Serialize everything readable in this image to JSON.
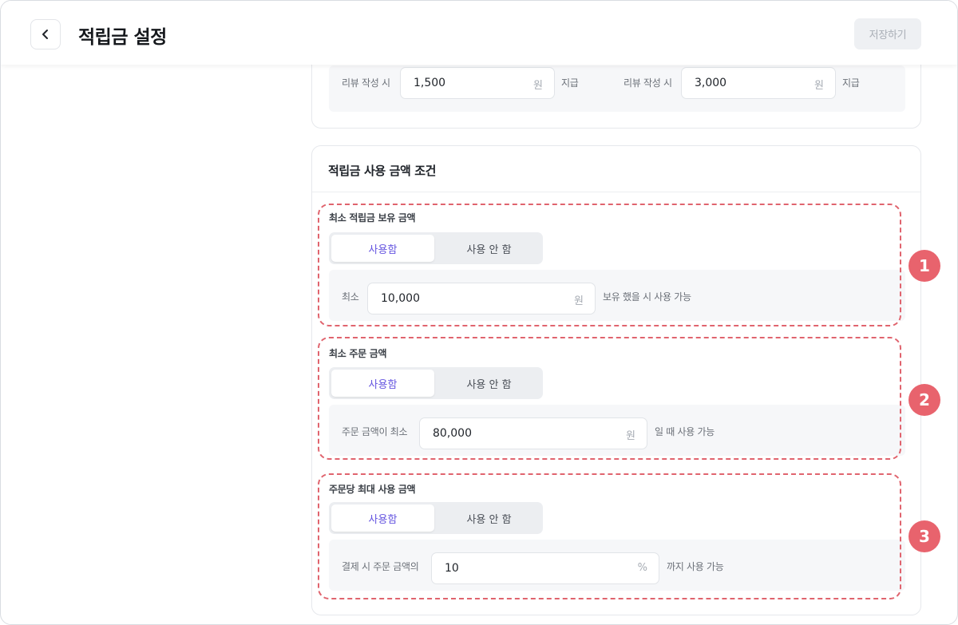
{
  "header": {
    "title": "적립금 설정",
    "save_label": "저장하기"
  },
  "review": {
    "left_label": "리뷰 작성 시",
    "left_value": "1,500",
    "left_unit": "원",
    "left_suffix": "지급",
    "right_label": "리뷰 작성 시",
    "right_value": "3,000",
    "right_unit": "원",
    "right_suffix": "지급"
  },
  "usage": {
    "title": "적립금 사용 금액 조건",
    "sections": [
      {
        "title": "최소 적립금 보유 금액",
        "toggle_on": "사용함",
        "toggle_off": "사용 안 함",
        "prefix": "최소",
        "value": "10,000",
        "unit": "원",
        "suffix": "보유 했을 시 사용 가능",
        "badge": "1"
      },
      {
        "title": "최소 주문 금액",
        "toggle_on": "사용함",
        "toggle_off": "사용 안 함",
        "prefix": "주문 금액이 최소",
        "value": "80,000",
        "unit": "원",
        "suffix": "일 때 사용 가능",
        "badge": "2"
      },
      {
        "title": "주문당 최대 사용 금액",
        "toggle_on": "사용함",
        "toggle_off": "사용 안 함",
        "prefix": "결제 시 주문 금액의",
        "value": "10",
        "unit": "%",
        "suffix": "까지 사용 가능",
        "badge": "3"
      }
    ]
  },
  "colors": {
    "accent": "#6656e0",
    "annotation": "#e8636d"
  },
  "icons": {
    "back": "chevron-left-icon"
  }
}
